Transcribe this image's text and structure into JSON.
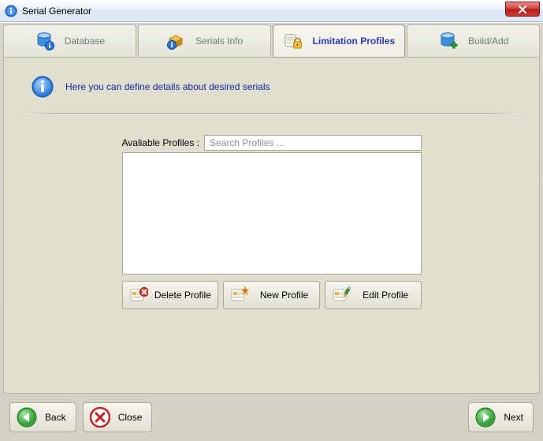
{
  "window": {
    "title": "Serial Generator"
  },
  "tabs": {
    "database": "Database",
    "serials_info": "Serials Info",
    "limitation_profiles": "Limitation Profiles",
    "build_add": "Build/Add"
  },
  "panel": {
    "info_text": "Here you can define details about desired serials",
    "available_profiles_label": "Avaliable Profiles :",
    "search_placeholder": "Search Profiles ..."
  },
  "buttons": {
    "delete_profile": "Delete Profile",
    "new_profile": "New Profile",
    "edit_profile": "Edit Profile",
    "back": "Back",
    "close": "Close",
    "next": "Next"
  }
}
